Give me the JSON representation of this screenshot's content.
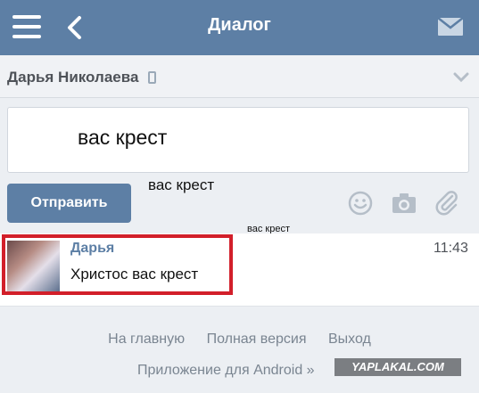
{
  "header": {
    "title": "Диалог"
  },
  "contact": {
    "name": "Дарья Николаева"
  },
  "compose": {
    "input_value": "вас крест",
    "send_label": "Отправить",
    "overlay_caption_1": "вас крест",
    "overlay_caption_2": "вас крест"
  },
  "dialog": {
    "sender": "Дарья",
    "text": "Христос вас крест",
    "time": "11:43"
  },
  "footer": {
    "links": [
      "На главную",
      "Полная версия",
      "Выход"
    ],
    "app_link": "Приложение для Android »",
    "watermark": "YAPLAKAL.COM"
  },
  "colors": {
    "accent": "#5d7fa5",
    "highlight": "#d21f2a"
  }
}
